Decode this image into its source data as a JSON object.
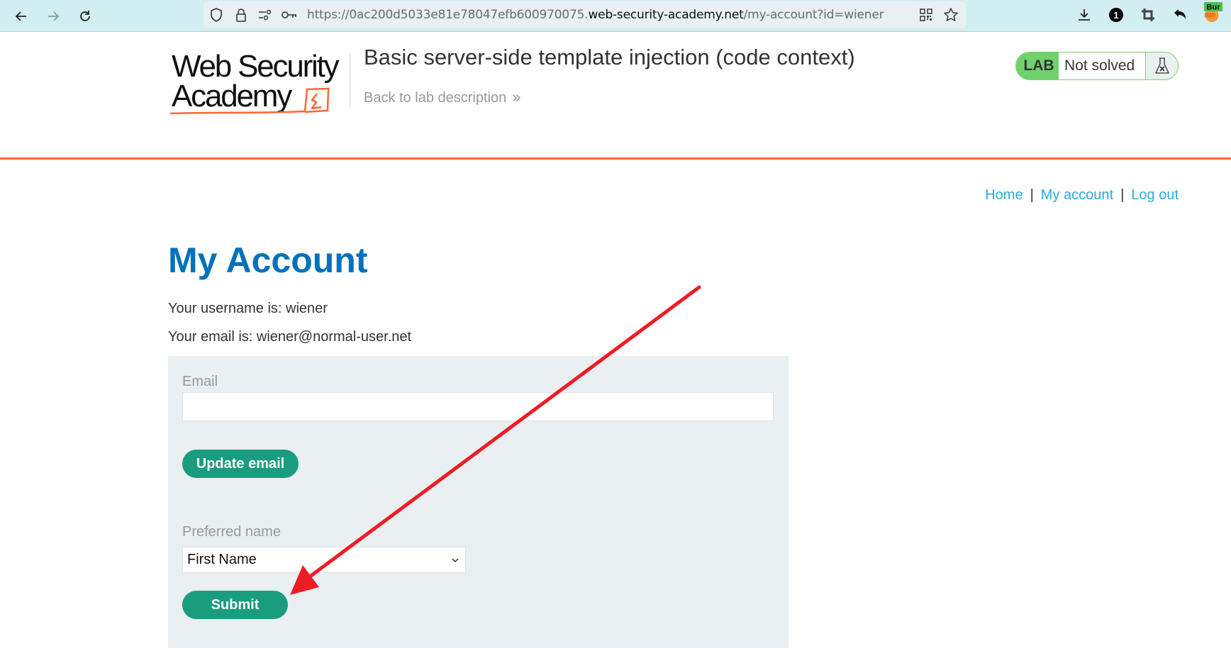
{
  "browser": {
    "url_prefix": "https://0ac200d5033e81e78047efb600970075.",
    "url_host": "web-security-academy.net",
    "url_path": "/my-account?id=wiener",
    "icons": [
      "back-arrow-icon",
      "forward-arrow-icon",
      "reload-icon",
      "shield-icon",
      "lock-icon",
      "permissions-icon",
      "key-icon",
      "qr-code-icon",
      "star-icon",
      "download-icon",
      "notification-badge-icon",
      "crop-icon",
      "undo-icon",
      "burp-extension-icon"
    ],
    "notification_count": "1",
    "extension_label": "Bur"
  },
  "header": {
    "logo_line1": "Web Security",
    "logo_line2": "Academy",
    "lab_title": "Basic server-side template injection (code context)",
    "back_link": "Back to lab description",
    "back_link_chevron": "»",
    "lab_badge": {
      "tag": "LAB",
      "status": "Not solved",
      "icon": "flask-icon"
    }
  },
  "nav": {
    "items": [
      {
        "label": "Home"
      },
      {
        "label": "My account"
      },
      {
        "label": "Log out"
      }
    ],
    "separator": "|"
  },
  "main": {
    "title": "My Account",
    "username_line": "Your username is: wiener",
    "email_line": "Your email is: wiener@normal-user.net",
    "form": {
      "email_label": "Email",
      "email_value": "",
      "email_placeholder": "",
      "update_email_button": "Update email",
      "preferred_name_label": "Preferred name",
      "preferred_name_selected": "First Name",
      "submit_button": "Submit"
    }
  },
  "colors": {
    "accent_orange": "#ff6633",
    "title_blue": "#0071bc",
    "link_blue": "#29abe0",
    "button_green": "#1a9c7e",
    "lab_green": "#70d16d",
    "annotation_red": "#ee1c25"
  },
  "annotation": {
    "type": "arrow",
    "points_to": "submit-button"
  }
}
